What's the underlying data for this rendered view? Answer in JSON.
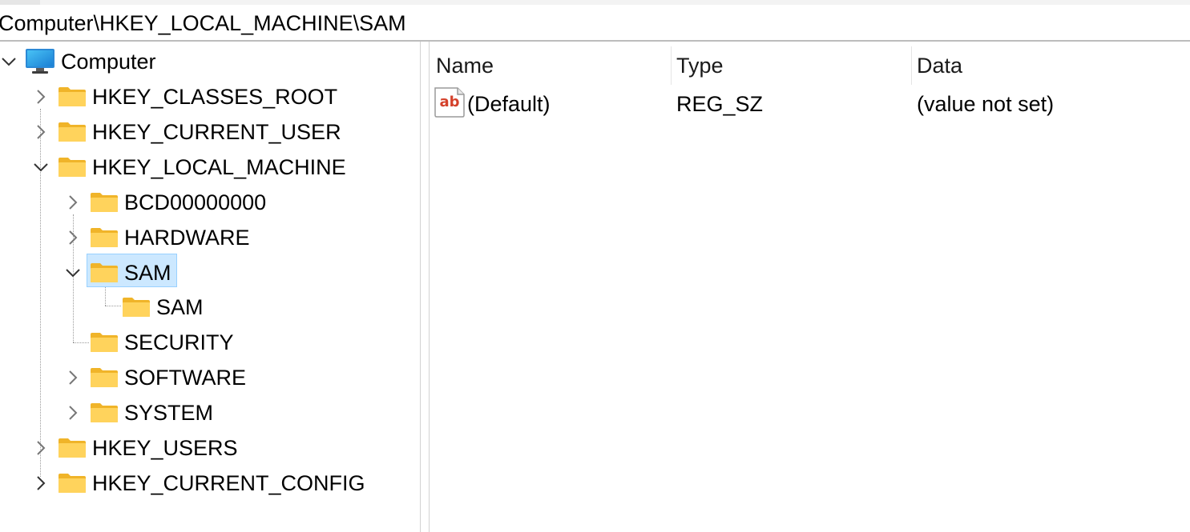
{
  "address": {
    "path": "Computer\\HKEY_LOCAL_MACHINE\\SAM"
  },
  "tree": {
    "root": "Computer",
    "hkcr": "HKEY_CLASSES_ROOT",
    "hkcu": "HKEY_CURRENT_USER",
    "hklm": "HKEY_LOCAL_MACHINE",
    "hklm_children": {
      "bcd": "BCD00000000",
      "hardware": "HARDWARE",
      "sam": "SAM",
      "sam_child": "SAM",
      "security": "SECURITY",
      "software": "SOFTWARE",
      "system": "SYSTEM"
    },
    "hku": "HKEY_USERS",
    "hkcc": "HKEY_CURRENT_CONFIG"
  },
  "list": {
    "columns": {
      "name": "Name",
      "type": "Type",
      "data": "Data"
    },
    "rows": [
      {
        "name": "(Default)",
        "type": "REG_SZ",
        "data": "(value not set)",
        "icon": "string-value-icon"
      }
    ]
  },
  "colors": {
    "selection_bg": "#cce8ff",
    "selection_border": "#99d1ff",
    "folder_yellow": "#ffcc4d",
    "ab_red": "#d4412b"
  }
}
